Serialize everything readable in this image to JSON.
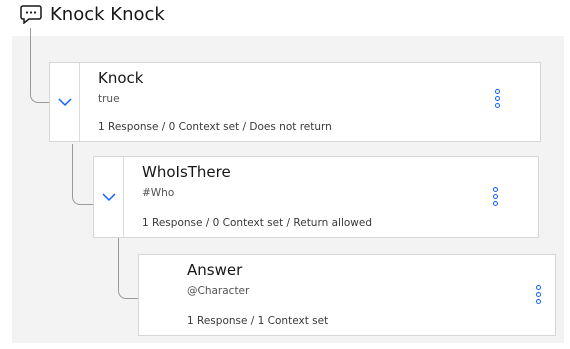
{
  "header": {
    "title": "Knock Knock",
    "icon": "chat-bubble-icon"
  },
  "nodes": [
    {
      "name": "Knock",
      "condition": "true",
      "summary": "1 Response / 0 Context set / Does not return"
    },
    {
      "name": "WhoIsThere",
      "condition": "#Who",
      "summary": "1 Response / 0 Context set / Return allowed"
    },
    {
      "name": "Answer",
      "condition": "@Character",
      "summary": "1 Response / 1 Context set"
    }
  ],
  "colors": {
    "accent": "#0f62fe",
    "canvas": "#f3f3f3",
    "connector": "#9a9a9a"
  }
}
